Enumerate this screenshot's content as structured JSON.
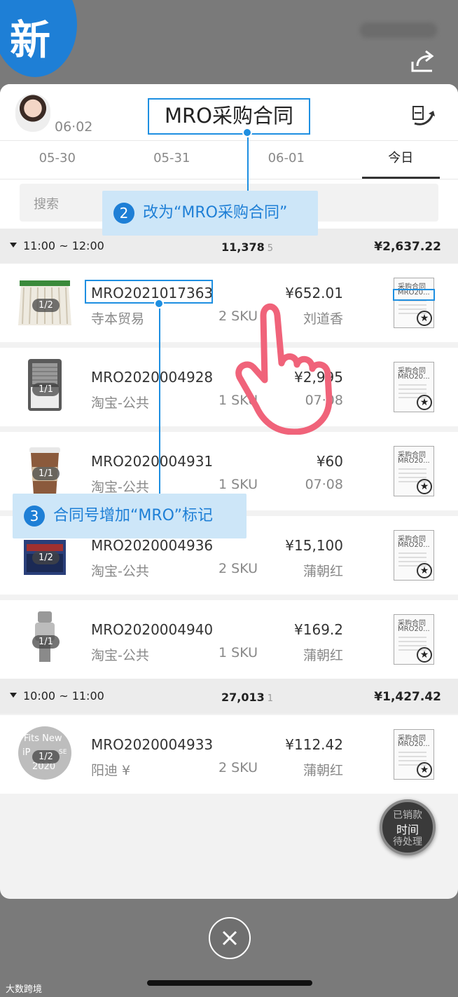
{
  "badge": {
    "text": "新"
  },
  "header": {
    "date": "06·02",
    "title": "MRO采购合同"
  },
  "tabs": [
    {
      "label": "05-30",
      "active": false
    },
    {
      "label": "05-31",
      "active": false
    },
    {
      "label": "06-01",
      "active": false
    },
    {
      "label": "今日",
      "active": true
    }
  ],
  "search": {
    "placeholder": "搜索"
  },
  "groups": [
    {
      "time": "11:00 ~ 12:00",
      "qty": "11,378",
      "count": "5",
      "amount": "¥2,637.22"
    },
    {
      "time": "10:00 ~ 11:00",
      "qty": "27,013",
      "count": "1",
      "amount": "¥1,427.42"
    }
  ],
  "rows": [
    {
      "pill": "1/2",
      "code": "MRO2021017363",
      "vendor": "寺本贸易",
      "sku": "2 SKU",
      "price": "¥652.01",
      "buyer": "刘道香",
      "doc_title": "采购合同",
      "doc_sub": "MRO20..."
    },
    {
      "pill": "1/1",
      "code": "MRO2020004928",
      "vendor": "淘宝-公共",
      "sku": "1 SKU",
      "price": "¥2,995",
      "buyer": "07·08",
      "doc_title": "采购合同",
      "doc_sub": "MRO20..."
    },
    {
      "pill": "1/1",
      "code": "MRO2020004931",
      "vendor": "淘宝-公共",
      "sku": "1 SKU",
      "price": "¥60",
      "buyer": "07·08",
      "doc_title": "采购合同",
      "doc_sub": "MRO20..."
    },
    {
      "pill": "1/2",
      "code": "MRO2020004936",
      "vendor": "淘宝-公共",
      "sku": "2 SKU",
      "price": "¥15,100",
      "buyer": "蒲朝红",
      "doc_title": "采购合同",
      "doc_sub": "MRO20..."
    },
    {
      "pill": "1/1",
      "code": "MRO2020004940",
      "vendor": "淘宝-公共",
      "sku": "1 SKU",
      "price": "¥169.2",
      "buyer": "蒲朝红",
      "doc_title": "采购合同",
      "doc_sub": "MRO20..."
    },
    {
      "pill": "1/2",
      "code": "MRO2020004933",
      "vendor": "阳迪 ¥",
      "sku": "2 SKU",
      "price": "¥112.42",
      "buyer": "蒲朝红",
      "doc_title": "采购合同",
      "doc_sub": "MRO20...",
      "thumb_text": [
        "Fits New",
        "iP",
        "SE",
        "2020"
      ]
    }
  ],
  "float_button": {
    "line1": "已销款",
    "line2": "时间",
    "line3": "待处理"
  },
  "annotations": [
    {
      "num": "2",
      "text": "改为“MRO采购合同”"
    },
    {
      "num": "3",
      "text": "合同号增加“MRO”标记"
    }
  ],
  "watermark": "大数跨境",
  "colors": {
    "accent": "#1e7fd6",
    "callout_bg": "#cde6f8",
    "hand": "#f0637a"
  }
}
